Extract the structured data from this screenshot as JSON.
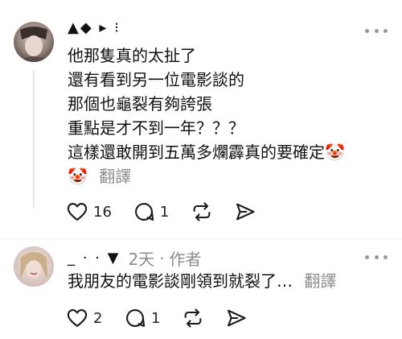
{
  "comments": [
    {
      "username_visible": "▲◆ ▸ ⁝",
      "lines": [
        "他那隻真的太扯了",
        "還有看到另一位電影談的",
        "那個也龜裂有夠誇張",
        "重點是才不到一年？？？",
        "這樣還敢開到五萬多爛霹真的要確定🤡"
      ],
      "last_line_emoji": "🤡",
      "translate_label": "翻譯",
      "likes": "16",
      "replies": "1"
    },
    {
      "username_visible": "_  ·   ·  ▼",
      "time": "2天",
      "separator": "·",
      "author_tag": "作者",
      "text": "我朋友的電影談剛領到就裂了…",
      "translate_label": "翻譯",
      "likes": "2",
      "replies": "1"
    }
  ],
  "colors": {
    "text": "#111111",
    "muted": "#8c8c8c",
    "icon": "#1a1a1a"
  }
}
